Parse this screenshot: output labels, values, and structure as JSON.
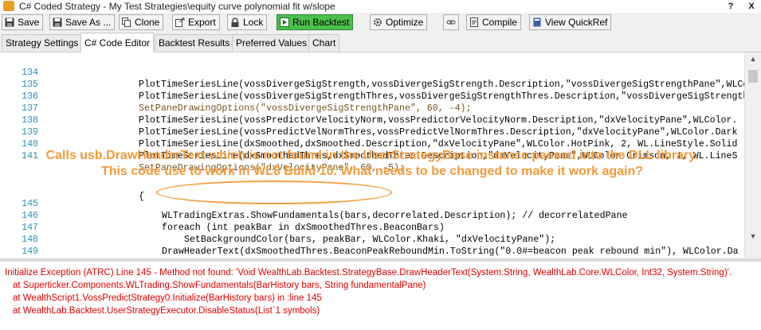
{
  "window": {
    "title": "C# Coded Strategy - My Test Strategies\\equity curve polynomial fit w/slope",
    "help_label": "?",
    "close_label": "X"
  },
  "toolbar": {
    "save": "Save",
    "save_as": "Save As ...",
    "clone": "Clone",
    "export": "Export",
    "lock": "Lock",
    "run_backtest": "Run Backtest",
    "optimize": "Optimize",
    "compile": "Compile",
    "view_quickref": "View QuickRef"
  },
  "tabs": [
    "Strategy Settings",
    "C# Code Editor",
    "Backtest Results",
    "Preferred Values",
    "Chart"
  ],
  "code": {
    "lines": [
      {
        "n": "134",
        "t": "PlotTimeSeriesLine(vossDivergeSigStrength,vossDivergeSigStrength.Description,\"vossDivergeSigStrengthPane\",WLColor."
      },
      {
        "n": "135",
        "t": "PlotTimeSeriesLine(vossDivergeSigStrengthThres,vossDivergeSigStrengthThres.Description,\"vossDivergeSigStrength"
      },
      {
        "n": "136",
        "t": "SetPaneDrawingOptions(\"vossDivergeSigStrengthPane\", 60, -4);"
      },
      {
        "n": "137",
        "t": "PlotTimeSeriesLine(vossPredictorVelocityNorm,vossPredictorVelocityNorm.Description,\"dxVelocityPane\",WLColor."
      },
      {
        "n": "138",
        "t": "PlotTimeSeriesLine(vossPredictVelNormThres,vossPredictVelNormThres.Description,\"dxVelocityPane\",WLColor.Dark"
      },
      {
        "n": "139",
        "t": "PlotTimeSeriesLine(dxSmoothed,dxSmoothed.Description,\"dxVelocityPane\",WLColor.HotPink, 2, WL.LineStyle.Solid"
      },
      {
        "n": "140",
        "t": "PlotTimeSeriesLine(dxSmoothedThres,dxSmoothedThres.Description,\"dxVelocityPane\",WLColor.Crimson, 1, WL.LineS"
      },
      {
        "n": "141",
        "t": "SetPaneDrawingOptions(\"dxVelocityPane\", 60, -5);"
      },
      {
        "n": "145",
        "t": "WLTradingExtras.ShowFundamentals(bars,decorrelated.Description); // decorrelatedPane"
      },
      {
        "n": "146",
        "t": "foreach (int peakBar in dxSmoothedThres.BeaconBars)"
      },
      {
        "n": "147",
        "t": "SetBackgroundColor(bars, peakBar, WLColor.Khaki, \"dxVelocityPane\");"
      },
      {
        "n": "148",
        "t": "DrawHeaderText(dxSmoothedThres.BeaconPeakReboundMin.ToString(\"0.0#=beacon peak rebound min\"), WLColor.Da"
      },
      {
        "n": "149",
        "t": ""
      }
    ],
    "brace": "{"
  },
  "annotation": {
    "line1": "Calls usb.DrawHeaderText which is not found in the UserStrategyBase instance passed into the DLL library.",
    "line2": "This code use to work in WL8 Build 10. What needs to be changed to make it work again?"
  },
  "errors": [
    "Initialize Exception (ATRC) Line 145 - Method not found: 'Void WealthLab.Backtest.StrategyBase.DrawHeaderText(System.String, WealthLab.Core.WLColor, Int32, System.String)'.",
    "at Superticker.Components.WLTrading.ShowFundamentals(BarHistory bars, String fundamentalPane)",
    "at WealthScript1.VossPredictStrategy0.Initialize(BarHistory bars) in :line 145",
    "at WealthLab.Backtest.UserStrategyExecutor.DisableStatus(List`1 symbols)"
  ],
  "colors": {
    "annotation": "#f39a3a",
    "error": "#e00000",
    "line_number": "#2b91af",
    "run_button": "#4cc04c"
  }
}
